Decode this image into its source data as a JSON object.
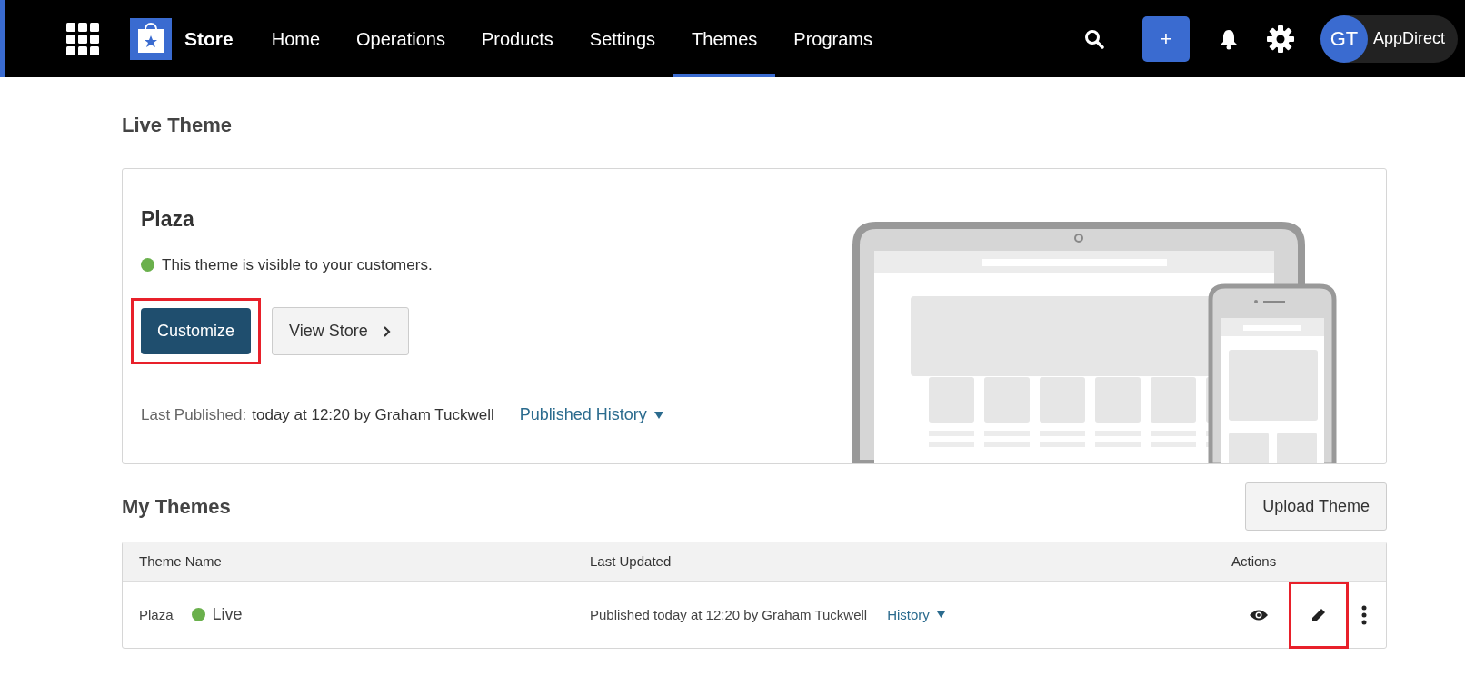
{
  "navbar": {
    "brand": "Store",
    "items": [
      {
        "label": "Home",
        "selected": false
      },
      {
        "label": "Operations",
        "selected": false
      },
      {
        "label": "Products",
        "selected": false
      },
      {
        "label": "Settings",
        "selected": false
      },
      {
        "label": "Themes",
        "selected": true
      },
      {
        "label": "Programs",
        "selected": false
      }
    ],
    "add_button": "+",
    "avatar_initials": "GT",
    "account_name": "AppDirect"
  },
  "live_theme": {
    "heading": "Live Theme",
    "name": "Plaza",
    "status_text": "This theme is visible to your customers.",
    "customize_button": {
      "label": "Customize",
      "highlighted": true
    },
    "view_store_button": "View Store",
    "last_published_label": "Last Published:",
    "last_published_value": "today at 12:20 by Graham Tuckwell",
    "history_link": "Published History"
  },
  "my_themes": {
    "heading": "My Themes",
    "upload_button": "Upload Theme",
    "table": {
      "columns": [
        "Theme Name",
        "Last Updated",
        "Actions"
      ],
      "rows": [
        {
          "name": "Plaza",
          "status_label": "Live",
          "last_updated": "Published today at 12:20 by Graham Tuckwell",
          "history_link": "History",
          "edit_highlighted": true
        }
      ]
    }
  }
}
